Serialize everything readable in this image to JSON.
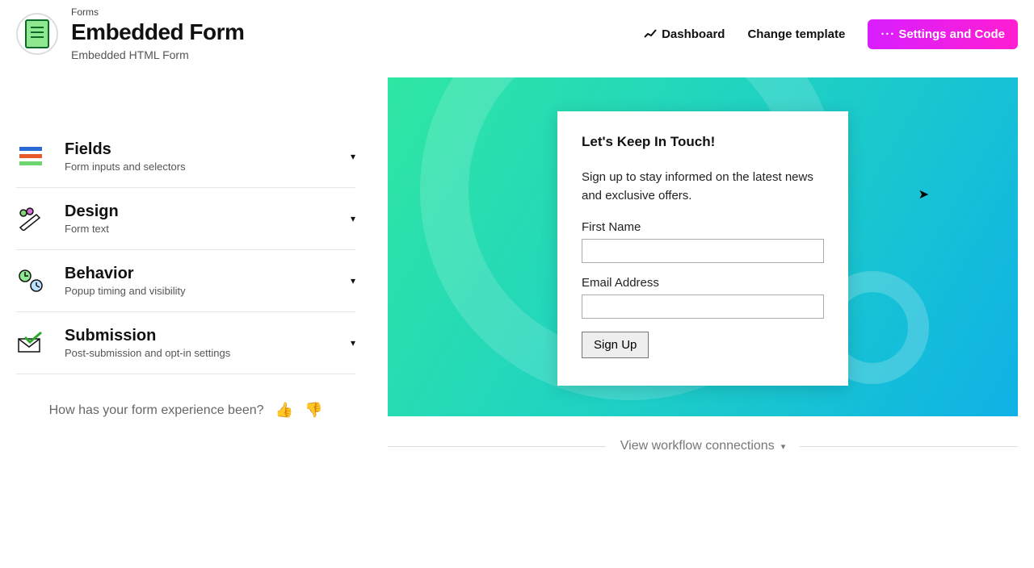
{
  "header": {
    "breadcrumb": "Forms",
    "title": "Embedded Form",
    "subtitle": "Embedded HTML Form",
    "nav": {
      "dashboard": "Dashboard",
      "change_template": "Change template",
      "settings_code": "Settings and Code"
    }
  },
  "sidebar": {
    "items": [
      {
        "title": "Fields",
        "subtitle": "Form inputs and selectors"
      },
      {
        "title": "Design",
        "subtitle": "Form text"
      },
      {
        "title": "Behavior",
        "subtitle": "Popup timing and visibility"
      },
      {
        "title": "Submission",
        "subtitle": "Post-submission and opt-in settings"
      }
    ],
    "feedback_prompt": "How has your form experience been?"
  },
  "preview": {
    "form": {
      "heading": "Let's Keep In Touch!",
      "description": "Sign up to stay informed on the latest news and exclusive offers.",
      "first_name_label": "First Name",
      "email_label": "Email Address",
      "submit_label": "Sign Up"
    }
  },
  "workflow": {
    "link": "View workflow connections"
  }
}
